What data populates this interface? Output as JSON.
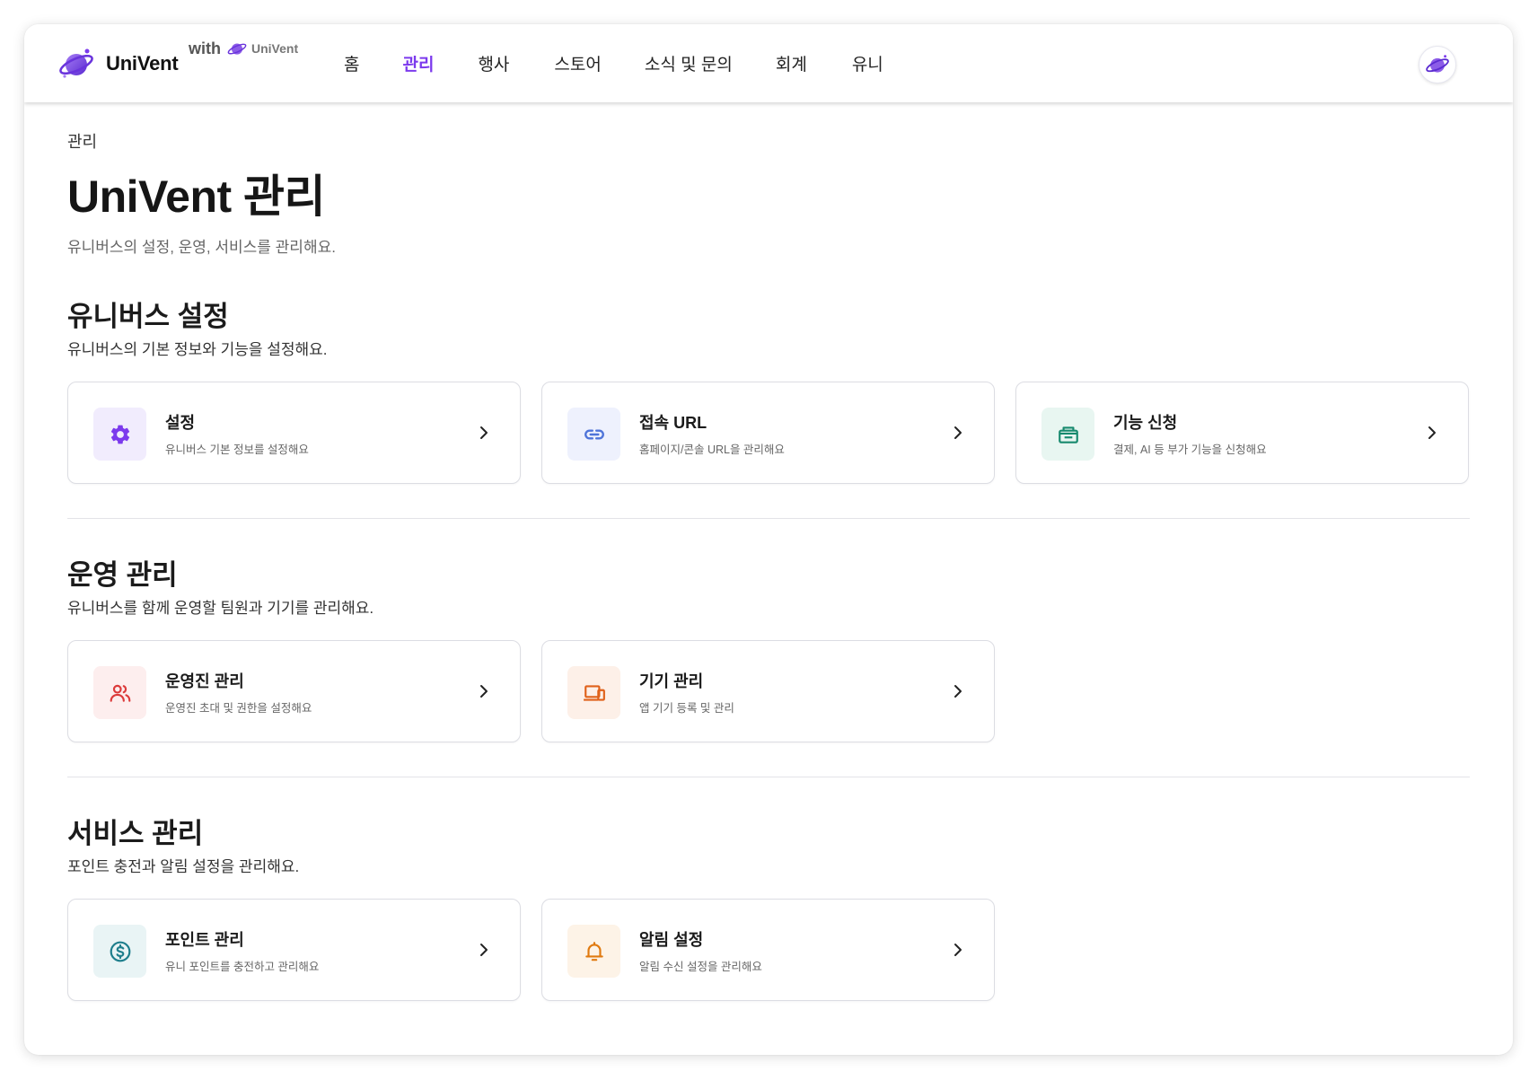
{
  "header": {
    "brand_name": "UniVent",
    "with_text": "with",
    "with_brand": "UniVent",
    "nav": [
      {
        "label": "홈",
        "active": false
      },
      {
        "label": "관리",
        "active": true
      },
      {
        "label": "행사",
        "active": false
      },
      {
        "label": "스토어",
        "active": false
      },
      {
        "label": "소식 및 문의",
        "active": false
      },
      {
        "label": "회계",
        "active": false
      },
      {
        "label": "유니",
        "active": false
      }
    ]
  },
  "page": {
    "breadcrumb": "관리",
    "title": "UniVent 관리",
    "description": "유니버스의 설정, 운영, 서비스를 관리해요."
  },
  "sections": [
    {
      "title": "유니버스 설정",
      "description": "유니버스의 기본 정보와 기능을 설정해요.",
      "cards": [
        {
          "title": "설정",
          "subtitle": "유니버스 기본 정보를 설정해요",
          "icon": "gear-icon",
          "icon_color": "#7c3aed",
          "icon_bg": "#f1ecfd"
        },
        {
          "title": "접속 URL",
          "subtitle": "홈페이지/콘솔 URL을 관리해요",
          "icon": "link-icon",
          "icon_color": "#4f74d9",
          "icon_bg": "#eef1fd"
        },
        {
          "title": "기능 신청",
          "subtitle": "결제, AI 등 부가 기능을 신청해요",
          "icon": "storefront-icon",
          "icon_color": "#178a6e",
          "icon_bg": "#e8f6f1"
        }
      ]
    },
    {
      "title": "운영 관리",
      "description": "유니버스를 함께 운영할 팀원과 기기를 관리해요.",
      "cards": [
        {
          "title": "운영진 관리",
          "subtitle": "운영진 초대 및 권한을 설정해요",
          "icon": "users-icon",
          "icon_color": "#dc3b3b",
          "icon_bg": "#fdeeee"
        },
        {
          "title": "기기 관리",
          "subtitle": "앱 기기 등록 및 관리",
          "icon": "devices-icon",
          "icon_color": "#e0621b",
          "icon_bg": "#fdf0e8"
        }
      ]
    },
    {
      "title": "서비스 관리",
      "description": "포인트 충전과 알림 설정을 관리해요.",
      "cards": [
        {
          "title": "포인트 관리",
          "subtitle": "유니 포인트를 충전하고 관리해요",
          "icon": "coin-icon",
          "icon_color": "#1e7e8c",
          "icon_bg": "#e9f4f5"
        },
        {
          "title": "알림 설정",
          "subtitle": "알림 수신 설정을 관리해요",
          "icon": "bell-icon",
          "icon_color": "#e07a10",
          "icon_bg": "#fdf3e7"
        }
      ]
    }
  ],
  "colors": {
    "accent": "#7c3aed"
  }
}
